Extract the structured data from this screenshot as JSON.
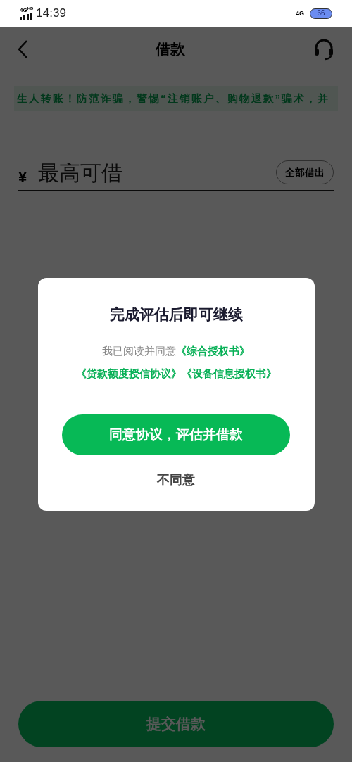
{
  "status_bar": {
    "network": "4G",
    "network_badge": "HD",
    "time": "14:39",
    "data_type": "4G",
    "battery": "66"
  },
  "nav": {
    "title": "借款"
  },
  "notice": {
    "text": "生人转账！防范诈骗，警惕“注销账户、购物退款”骗术，并"
  },
  "amount": {
    "currency": "¥",
    "placeholder": "最高可借",
    "all_button": "全部借出"
  },
  "submit_button": "提交借款",
  "dialog": {
    "title": "完成评估后即可继续",
    "prefix": "我已阅读并同意",
    "links": [
      "《综合授权书》",
      "《贷款额度授信协议》",
      "《设备信息授权书》"
    ],
    "agree_button": "同意协议，评估并借款",
    "decline_button": "不同意"
  }
}
